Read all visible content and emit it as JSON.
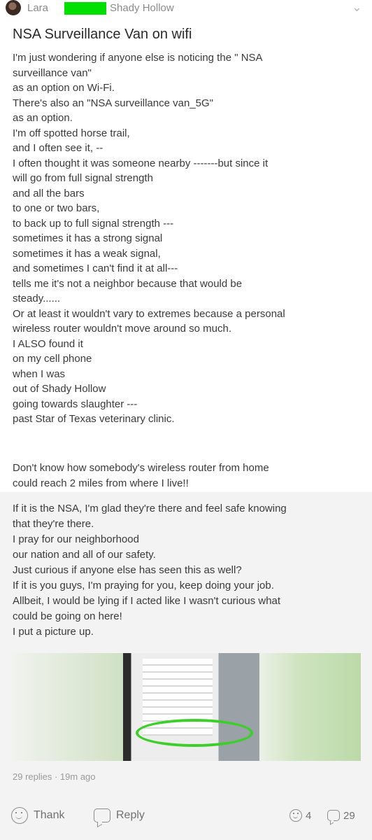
{
  "post": {
    "author": "Lara",
    "group": "Shady Hollow",
    "title": "NSA Surveillance Van on wifi",
    "body_lines": [
      "I'm just wondering if anyone else is noticing the \" NSA",
      "surveillance van\"",
      "as an option on Wi-Fi.",
      "There's also an \"NSA surveillance van_5G\"",
      "as an option.",
      "I'm off spotted horse trail,",
      "and I often see it, --",
      "I often thought it was someone nearby -------but since it",
      "will go from full signal strength",
      "and all the bars",
      "to one or two bars,",
      "to back up to full signal strength ---",
      "sometimes it has a strong signal",
      "sometimes it has a weak signal,",
      "and sometimes I can't find it at all---",
      "tells me it's not a neighbor because that would be",
      "steady......",
      "Or at least it wouldn't vary to extremes because a personal",
      "wireless router wouldn't move around so much.",
      "I ALSO found it",
      "on my cell phone",
      "when I was",
      "out of Shady Hollow",
      "going towards slaughter ---",
      "past Star of Texas veterinary clinic."
    ],
    "para2_lines": [
      "Don't know how somebody's wireless router from home",
      "could reach 2 miles from where I live!!"
    ],
    "para3_lines": [
      "If it is the NSA, I'm glad they're there and feel safe knowing",
      "that they're there.",
      "I pray for our neighborhood",
      "our nation and all of our safety.",
      "Just curious if anyone else has seen this as well?",
      "If it is you guys, I'm praying for you, keep doing your job.",
      "Allbeit, I would be lying if I acted like I wasn't curious what",
      "could be going on here!",
      "I put a picture up."
    ],
    "meta": "29 replies · 19m ago",
    "actions": {
      "thank_label": "Thank",
      "reply_label": "Reply",
      "thank_count": "4",
      "reply_count": "29"
    }
  },
  "icons": {
    "overflow": "chevron-down-icon",
    "thank": "smiley-icon",
    "reply": "speech-bubble-icon"
  },
  "colors": {
    "redaction": "#00e000",
    "highlight_ring": "#3ccf2a"
  }
}
